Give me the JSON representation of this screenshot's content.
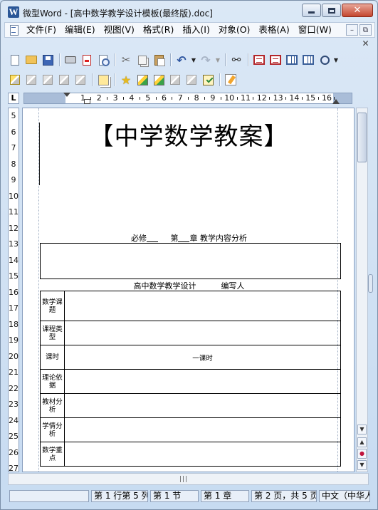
{
  "window": {
    "title": "微型Word - [高中数学教学设计模板(最终版).doc]",
    "app_icon_letter": "W"
  },
  "menu": {
    "items": [
      "文件(F)",
      "编辑(E)",
      "视图(V)",
      "格式(R)",
      "插入(I)",
      "对象(O)",
      "表格(A)",
      "窗口(W)"
    ]
  },
  "ruler": {
    "corner": "L",
    "h_numbers": [
      "1",
      "2",
      "3",
      "4",
      "5",
      "6",
      "7",
      "8",
      "9",
      "10",
      "11",
      "12",
      "13",
      "14",
      "15",
      "16"
    ],
    "v_numbers": [
      "5",
      "6",
      "7",
      "8",
      "9",
      "10",
      "11",
      "12",
      "13",
      "14",
      "15",
      "16",
      "17",
      "18",
      "19",
      "20",
      "21",
      "22",
      "23",
      "24",
      "25",
      "26",
      "27"
    ]
  },
  "document": {
    "title": "【中学数学教案】",
    "line1": {
      "part_a": "必修",
      "part_b": "第",
      "part_c": "章 教学内容分析"
    },
    "line2": "高中数学教学设计          编写人",
    "table_rows": [
      {
        "label": "数学课题",
        "value": ""
      },
      {
        "label": "课程类型",
        "value": ""
      },
      {
        "label": "课时",
        "value": "一课时"
      },
      {
        "label": "理论依据",
        "value": ""
      },
      {
        "label": "教材分析",
        "value": ""
      },
      {
        "label": "学情分析",
        "value": ""
      },
      {
        "label": "数学重点",
        "value": ""
      }
    ]
  },
  "status": {
    "position": "第 1 行第 5 列",
    "section": "第 1 节",
    "chapter": "第 1 章",
    "pages": "第 2 页，共 5 页",
    "language": "中文（中华人"
  }
}
